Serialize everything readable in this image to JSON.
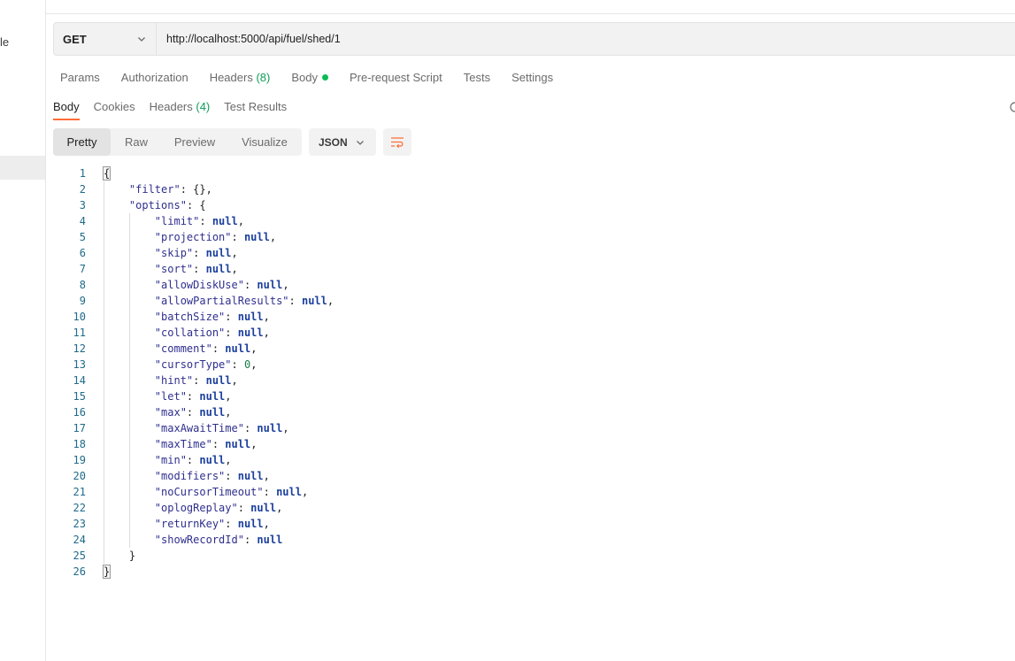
{
  "sidebar": {
    "fragment": "le"
  },
  "request": {
    "method": "GET",
    "url": "http://localhost:5000/api/fuel/shed/1"
  },
  "request_tabs": {
    "params": "Params",
    "authorization": "Authorization",
    "headers": "Headers",
    "headers_count": "(8)",
    "body": "Body",
    "prerequest": "Pre-request Script",
    "tests": "Tests",
    "settings": "Settings"
  },
  "response_tabs": {
    "body": "Body",
    "cookies": "Cookies",
    "headers": "Headers",
    "headers_count": "(4)",
    "test_results": "Test Results"
  },
  "view_modes": {
    "pretty": "Pretty",
    "raw": "Raw",
    "preview": "Preview",
    "visualize": "Visualize",
    "format": "JSON"
  },
  "colors": {
    "accent": "#ff6c37",
    "status_dot": "#0cbb52"
  },
  "code_lines": [
    "{",
    "    \"filter\": {},",
    "    \"options\": {",
    "        \"limit\": null,",
    "        \"projection\": null,",
    "        \"skip\": null,",
    "        \"sort\": null,",
    "        \"allowDiskUse\": null,",
    "        \"allowPartialResults\": null,",
    "        \"batchSize\": null,",
    "        \"collation\": null,",
    "        \"comment\": null,",
    "        \"cursorType\": 0,",
    "        \"hint\": null,",
    "        \"let\": null,",
    "        \"max\": null,",
    "        \"maxAwaitTime\": null,",
    "        \"maxTime\": null,",
    "        \"min\": null,",
    "        \"modifiers\": null,",
    "        \"noCursorTimeout\": null,",
    "        \"oplogReplay\": null,",
    "        \"returnKey\": null,",
    "        \"showRecordId\": null",
    "    }",
    "}"
  ]
}
